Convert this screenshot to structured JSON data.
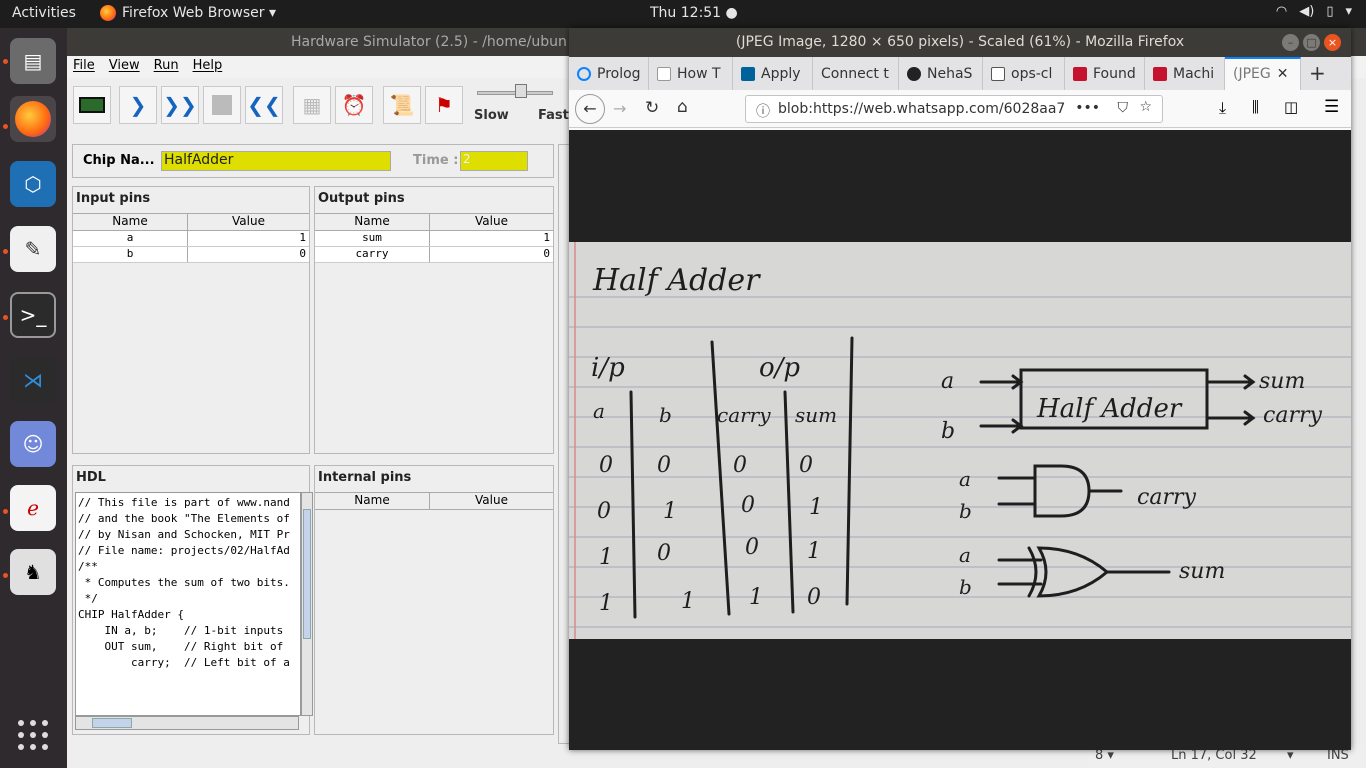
{
  "topbar": {
    "activities": "Activities",
    "app": "Firefox Web Browser ▾",
    "clock": "Thu 12:51 ●",
    "tray": [
      "wifi-icon",
      "volume-icon",
      "battery-icon",
      "power-icon"
    ]
  },
  "dock": {
    "items": [
      "files-icon",
      "firefox-icon",
      "virtualbox-icon",
      "text-editor-icon",
      "terminal-icon",
      "vscode-icon",
      "discord-icon",
      "libreoffice-icon",
      "java-icon"
    ],
    "apps": "show-apps-icon"
  },
  "hs": {
    "title": "Hardware Simulator (2.5) - /home/ubun",
    "menu": [
      "File",
      "View",
      "Run",
      "Help"
    ],
    "slow": "Slow",
    "fast": "Fast",
    "chip_label": "Chip Na...",
    "chip_name": "HalfAdder",
    "time_label": "Time :",
    "time_value": "2",
    "input_pins": {
      "title": "Input pins",
      "cols": [
        "Name",
        "Value"
      ],
      "rows": [
        [
          "a",
          "1"
        ],
        [
          "b",
          "0"
        ]
      ]
    },
    "output_pins": {
      "title": "Output pins",
      "cols": [
        "Name",
        "Value"
      ],
      "rows": [
        [
          "sum",
          "1"
        ],
        [
          "carry",
          "0"
        ]
      ]
    },
    "hdl": {
      "title": "HDL",
      "lines": [
        "// This file is part of www.nand",
        "// and the book \"The Elements of",
        "// by Nisan and Schocken, MIT Pr",
        "// File name: projects/02/HalfAd",
        "",
        "/**",
        " * Computes the sum of two bits.",
        " */",
        "",
        "CHIP HalfAdder {",
        "    IN a, b;    // 1-bit inputs",
        "    OUT sum,    // Right bit of",
        "        carry;  // Left bit of a"
      ]
    },
    "internal_pins": {
      "title": "Internal pins",
      "cols": [
        "Name",
        "Value"
      ]
    },
    "status": {
      "tab": "8 ▾",
      "pos": "Ln 17, Col 32",
      "mode": "INS"
    }
  },
  "firefox": {
    "title": "(JPEG Image, 1280 × 650 pixels) - Scaled (61%) - Mozilla Firefox",
    "tabs": [
      "Prolog",
      "How T",
      "Apply",
      "Connect t",
      "NehaS",
      "ops-cl",
      "Found",
      "Machi",
      "(JPEG"
    ],
    "url": "blob:https://web.whatsapp.com/6028aa7",
    "colors": {
      "accent": "#0a84ff",
      "ubuntu": "#e95420"
    }
  },
  "note": {
    "title": "Half Adder",
    "ip": "i/p",
    "op": "o/p",
    "cols": [
      "a",
      "b",
      "carry",
      "sum"
    ],
    "rows": [
      [
        "0",
        "0",
        "0",
        "0"
      ],
      [
        "0",
        "1",
        "0",
        "1"
      ],
      [
        "1",
        "0",
        "0",
        "1"
      ],
      [
        "1",
        "1",
        "1",
        "0"
      ]
    ],
    "block": "Half Adder",
    "in_a": "a",
    "in_b": "b",
    "out_sum": "sum",
    "out_carry": "carry",
    "and_a": "a",
    "and_b": "b",
    "and_out": "carry",
    "xor_a": "a",
    "xor_b": "b",
    "xor_out": "sum"
  }
}
